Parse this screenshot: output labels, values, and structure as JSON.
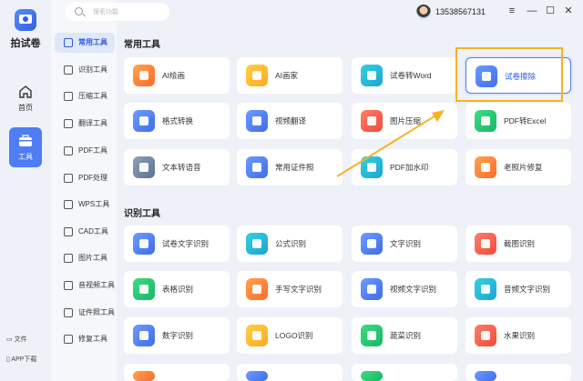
{
  "app": {
    "name": "拍试卷"
  },
  "rail": {
    "items": [
      {
        "label": "首页",
        "icon": "home-icon"
      },
      {
        "label": "工具",
        "icon": "toolbox-icon"
      }
    ],
    "footer": [
      "文件",
      "APP下载"
    ]
  },
  "menu": {
    "items": [
      {
        "label": "常用工具"
      },
      {
        "label": "识别工具"
      },
      {
        "label": "压缩工具"
      },
      {
        "label": "翻译工具"
      },
      {
        "label": "PDF工具"
      },
      {
        "label": "PDF处理"
      },
      {
        "label": "WPS工具"
      },
      {
        "label": "CAD工具"
      },
      {
        "label": "图片工具"
      },
      {
        "label": "音视频工具"
      },
      {
        "label": "证件照工具"
      },
      {
        "label": "修复工具"
      }
    ]
  },
  "search": {
    "placeholder": "搜索功能"
  },
  "user": {
    "phone": "13538567131"
  },
  "window": {
    "menu": "≡",
    "minimize": "—",
    "maximize": "☐",
    "close": "✕"
  },
  "sections": [
    {
      "title": "常用工具",
      "cards": [
        {
          "label": "AI绘画",
          "color": "#ff7a3a"
        },
        {
          "label": "AI画家",
          "color": "#ffb52a"
        },
        {
          "label": "试卷转Word",
          "color": "#22b4dc"
        },
        {
          "label": "试卷擦除",
          "color": "#4e7df4"
        },
        {
          "label": "格式转换",
          "color": "#4e7df4"
        },
        {
          "label": "视频翻译",
          "color": "#4e7df4"
        },
        {
          "label": "图片压缩",
          "color": "#ff6a4a"
        },
        {
          "label": "PDF转Excel",
          "color": "#22c46f"
        },
        {
          "label": "文本转语音",
          "color": "#6b7c98"
        },
        {
          "label": "常用证件照",
          "color": "#4e7df4"
        },
        {
          "label": "PDF加水印",
          "color": "#22b4dc"
        },
        {
          "label": "老照片修复",
          "color": "#ff7a3a"
        }
      ]
    },
    {
      "title": "识别工具",
      "cards": [
        {
          "label": "试卷文字识别",
          "color": "#4e7df4"
        },
        {
          "label": "公式识别",
          "color": "#22b4dc"
        },
        {
          "label": "文字识别",
          "color": "#4e7df4"
        },
        {
          "label": "截图识别",
          "color": "#ff6a4a"
        },
        {
          "label": "表格识别",
          "color": "#22c46f"
        },
        {
          "label": "手写文字识别",
          "color": "#ff7a3a"
        },
        {
          "label": "视频文字识别",
          "color": "#4e7df4"
        },
        {
          "label": "音频文字识别",
          "color": "#22b4dc"
        },
        {
          "label": "数字识别",
          "color": "#4e7df4"
        },
        {
          "label": "LOGO识别",
          "color": "#ffb52a"
        },
        {
          "label": "蔬菜识别",
          "color": "#22c46f"
        },
        {
          "label": "水果识别",
          "color": "#ff6a4a"
        }
      ]
    }
  ]
}
